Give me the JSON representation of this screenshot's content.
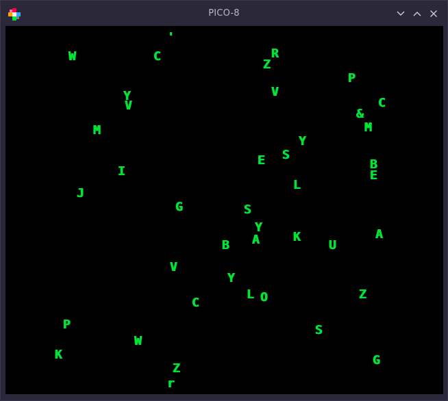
{
  "window": {
    "title": "PICO-8",
    "icon": "pico8-logo-icon",
    "controls": [
      "minimize-icon",
      "maximize-icon",
      "close-icon"
    ]
  },
  "screen": {
    "background": "#000000",
    "text_color": "#00e436",
    "chars": [
      {
        "text": "'"
      },
      {
        "text": "W"
      },
      {
        "text": "C"
      },
      {
        "text": "R"
      },
      {
        "text": "Z"
      },
      {
        "text": "P"
      },
      {
        "text": "V"
      },
      {
        "text": "Y"
      },
      {
        "text": "V"
      },
      {
        "text": "C"
      },
      {
        "text": "&"
      },
      {
        "text": "M"
      },
      {
        "text": "M"
      },
      {
        "text": "Y"
      },
      {
        "text": "E"
      },
      {
        "text": "S"
      },
      {
        "text": "B"
      },
      {
        "text": "E"
      },
      {
        "text": "I"
      },
      {
        "text": "L"
      },
      {
        "text": "J"
      },
      {
        "text": "G"
      },
      {
        "text": "S"
      },
      {
        "text": "Y"
      },
      {
        "text": "A"
      },
      {
        "text": "K"
      },
      {
        "text": "A"
      },
      {
        "text": "B"
      },
      {
        "text": "U"
      },
      {
        "text": "V"
      },
      {
        "text": "Y"
      },
      {
        "text": "L"
      },
      {
        "text": "O"
      },
      {
        "text": "Z"
      },
      {
        "text": "C"
      },
      {
        "text": "P"
      },
      {
        "text": "S"
      },
      {
        "text": "W"
      },
      {
        "text": "K"
      },
      {
        "text": "G"
      },
      {
        "text": "Z"
      },
      {
        "text": "r"
      }
    ]
  }
}
